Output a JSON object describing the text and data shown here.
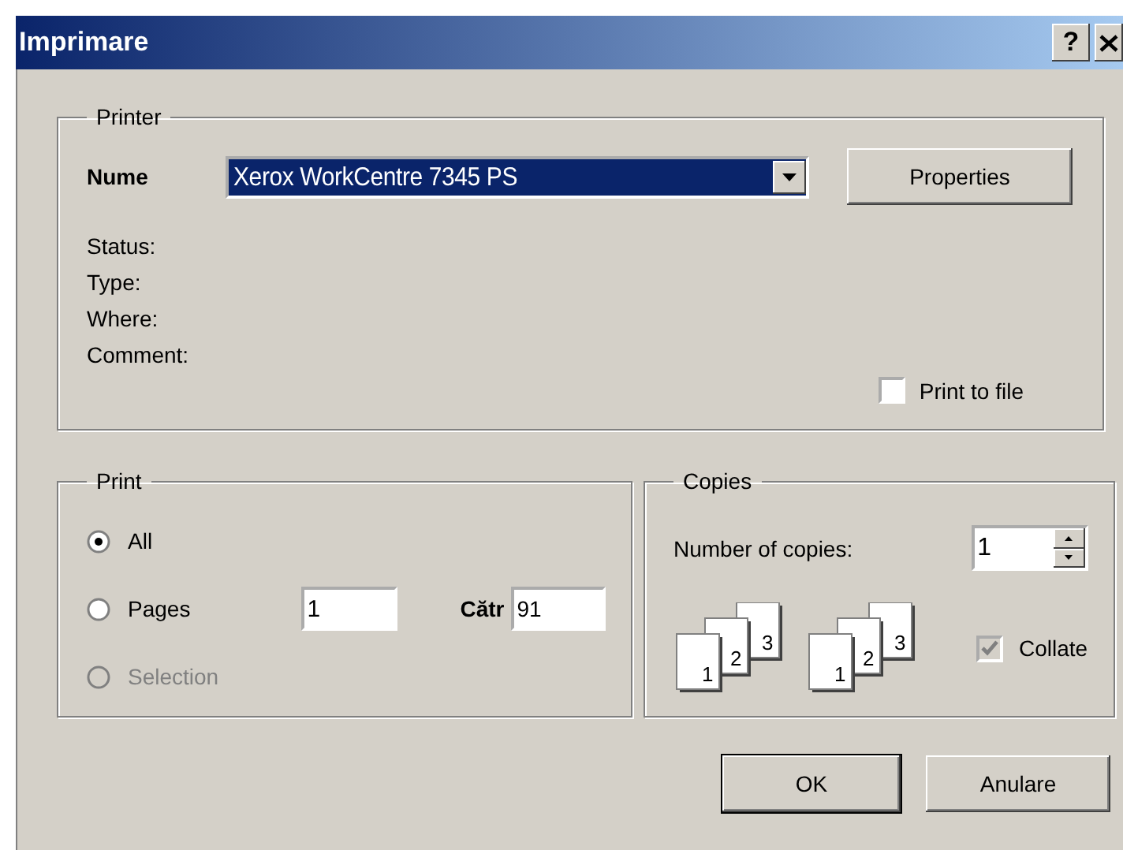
{
  "window": {
    "title": "Imprimare",
    "help_button": "?"
  },
  "printer": {
    "title": "Printer",
    "name_label": "Nume",
    "printer_name": "Xerox WorkCentre 7345 PS",
    "properties_button": "Properties",
    "info_labels": [
      "Status:",
      "Type:",
      "Where:",
      "Comment:"
    ],
    "print_to_file": {
      "label": "Print to file",
      "checked": false
    }
  },
  "print_range": {
    "title": "Print",
    "options": [
      {
        "label": "All",
        "selected": true,
        "disabled": false
      },
      {
        "label": "Pages",
        "selected": false,
        "disabled": false,
        "range": {
          "from": "1",
          "to_label": "Cătr",
          "to": "91"
        }
      },
      {
        "label": "Selection",
        "selected": false,
        "disabled": true
      }
    ]
  },
  "copies": {
    "title": "Copies",
    "count_label": "Number of copies:",
    "count": "1",
    "page_stacks": [
      [
        "1",
        "2",
        "3"
      ],
      [
        "1",
        "2",
        "3"
      ]
    ],
    "collate": {
      "label": "Collate",
      "checked": true,
      "disabled": true
    }
  },
  "buttons": [
    {
      "label": "OK",
      "default": true
    },
    {
      "label": "Anulare",
      "default": false
    }
  ]
}
